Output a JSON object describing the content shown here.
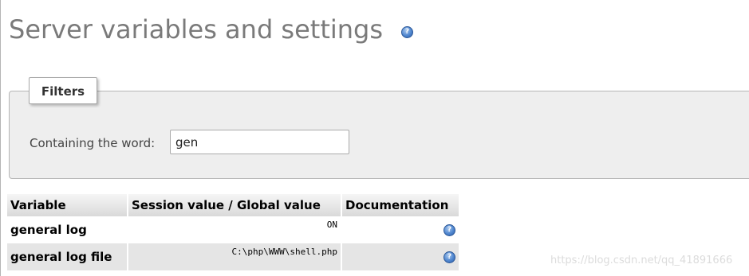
{
  "page": {
    "title": "Server variables and settings"
  },
  "filters": {
    "legend": "Filters",
    "label": "Containing the word:",
    "value": "gen"
  },
  "table": {
    "headers": [
      "Variable",
      "Session value / Global value",
      "Documentation"
    ],
    "rows": [
      {
        "name": "general log",
        "value": "ON"
      },
      {
        "name": "general log file",
        "value": "C:\\php\\WWW\\shell.php"
      }
    ]
  },
  "icons": {
    "help": "help-icon",
    "glyph": "?"
  },
  "colors": {
    "title": "#7a7a7a",
    "filters_background": "#eeeeee",
    "row_alt": "#e5e5e5",
    "help_icon": "#4f86cf"
  },
  "watermark": "https://blog.csdn.net/qq_41891666"
}
